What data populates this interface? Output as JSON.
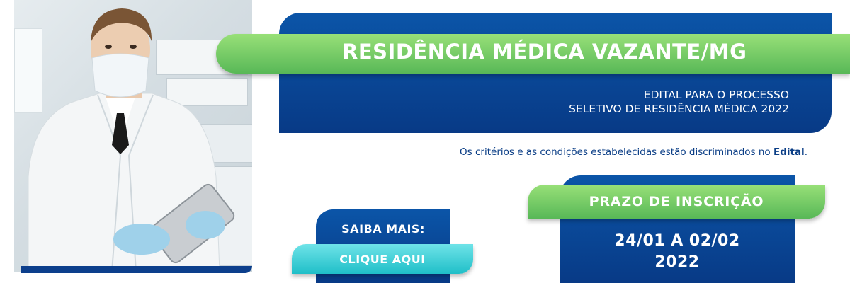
{
  "banner": {
    "title": "RESIDÊNCIA MÉDICA VAZANTE/MG",
    "subtitle_line1": "EDITAL PARA O PROCESSO",
    "subtitle_line2": "SELETIVO DE RESIDÊNCIA MÉDICA 2022",
    "criteria_text": "Os critérios e as condições estabelecidas estão discriminados no",
    "criteria_link": "Edital",
    "criteria_end": "."
  },
  "cta": {
    "saiba_label": "SAIBA MAIS:",
    "button_label": "CLIQUE AQUI"
  },
  "prazo": {
    "label": "PRAZO DE INSCRIÇÃO",
    "dates_line1": "24/01 A 02/02",
    "dates_line2": "2022"
  },
  "colors": {
    "navy": "#083a86",
    "blue": "#0b55a8",
    "green": "#58b857",
    "cyan": "#1fbfc8",
    "text_blue": "#0b3e86"
  }
}
